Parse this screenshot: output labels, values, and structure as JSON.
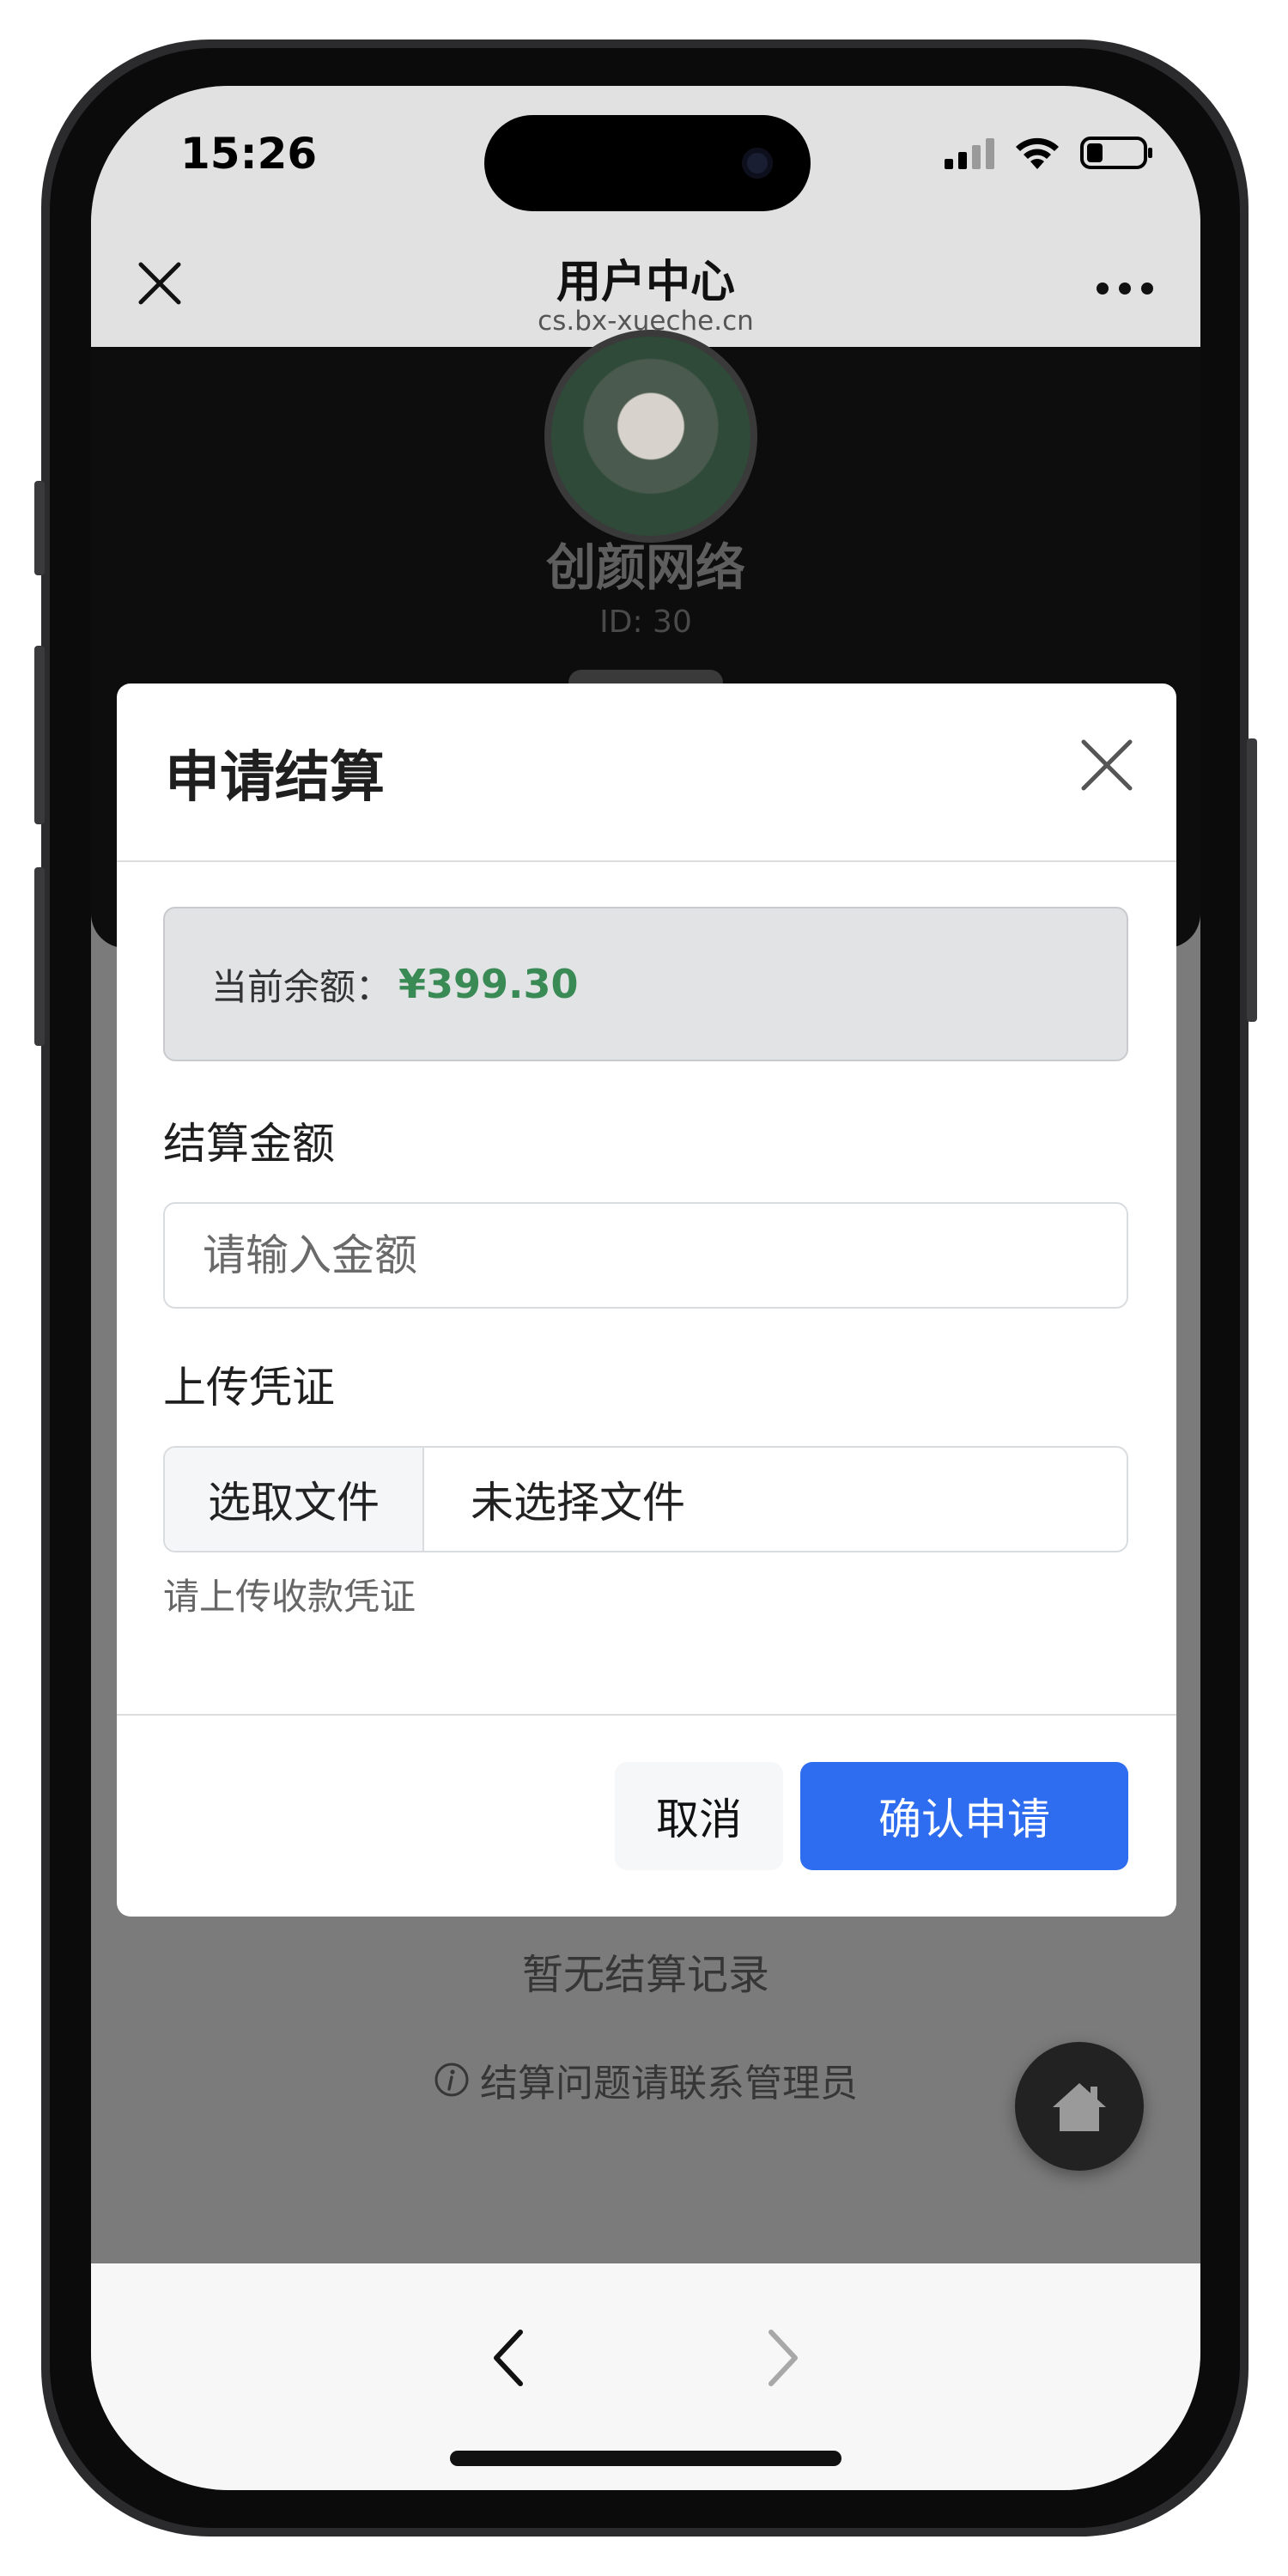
{
  "status_bar": {
    "time": "15:26"
  },
  "nav": {
    "title": "用户中心",
    "url": "cs.bx-xueche.cn"
  },
  "profile": {
    "name": "创颜网络",
    "id_label": "ID: 30"
  },
  "modal": {
    "title": "申请结算",
    "balance_label": "当前余额：",
    "balance_value": "¥399.30",
    "amount_label": "结算金额",
    "amount_placeholder": "请输入金额",
    "amount_value": "",
    "upload_label": "上传凭证",
    "choose_file_label": "选取文件",
    "no_file_label": "未选择文件",
    "upload_help": "请上传收款凭证",
    "cancel_label": "取消",
    "confirm_label": "确认申请"
  },
  "page": {
    "empty_records": "暂无结算记录",
    "admin_tip": "结算问题请联系管理员"
  },
  "colors": {
    "accent": "#2e6cf0",
    "balance": "#3a8a55",
    "overlay": "#7b7b7b"
  },
  "icons": {
    "nav_close": "close-icon",
    "nav_more": "more-dots-icon",
    "modal_close": "close-icon",
    "info": "info-icon",
    "home": "home-icon",
    "back": "chevron-left-icon",
    "forward": "chevron-right-icon"
  }
}
